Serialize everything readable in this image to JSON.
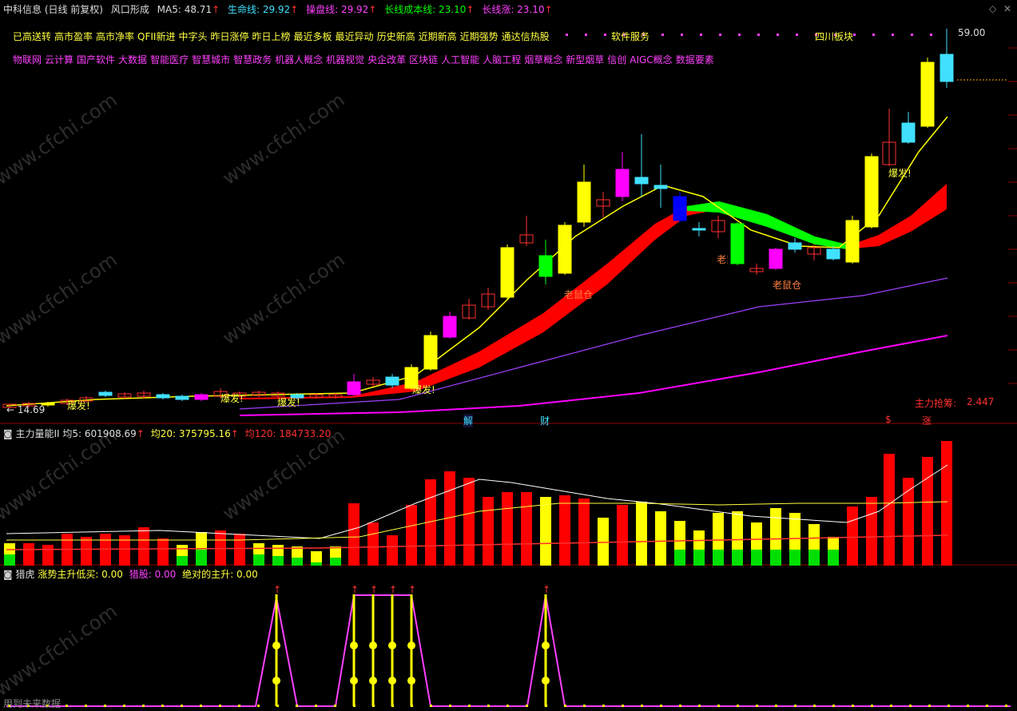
{
  "header": {
    "stock": "中科信息 (日线 前复权)",
    "indicator": "风口形成",
    "ma5": "MA5: 48.71",
    "lifeline": "生命线: 29.92",
    "opline": "操盘线: 29.92",
    "longcost": "长线成本线: 23.10",
    "longrise": "长线涨: 23.10",
    "arrow": "↑"
  },
  "tags_row1": [
    "已高送转",
    "高市盈率",
    "高市净率",
    "QFII新进",
    "中字头",
    "昨日涨停",
    "昨日上榜",
    "最近多板",
    "最近异动",
    "历史新高",
    "近期新高",
    "近期强势",
    "通达信热股"
  ],
  "tags_row1_extra": {
    "software": "软件服务",
    "sichuan": "四川板块"
  },
  "tags_row2": [
    "物联网",
    "云计算",
    "国产软件",
    "大数据",
    "智能医疗",
    "智慧城市",
    "智慧政务",
    "机器人概念",
    "机器视觉",
    "央企改革",
    "区块链",
    "人工智能",
    "人脑工程",
    "烟草概念",
    "新型烟草",
    "信创",
    "AIGC概念",
    "数据要素"
  ],
  "price_labels": {
    "high": "59.00",
    "low": "← 14.69",
    "baofa": "爆发!",
    "laoshucang": "老鼠仓",
    "mainforce": "主力抢筹:",
    "mainforce_value": "2.447",
    "jie": "解",
    "cai": "财",
    "zhang": "涨",
    "s": "$"
  },
  "panel2": {
    "title": "主力量能II",
    "avg5": "均5: 601908.69",
    "avg20": "均20: 375795.16",
    "avg120": "均120: 184733.20"
  },
  "panel3": {
    "title": "猎虎",
    "v1": "涨势主升低买: 0.00",
    "v2": "猎股: 0.00",
    "v3": "绝对的主升: 0.00"
  },
  "footer": "用到未来数据",
  "watermark": "www.cfchi.com",
  "colors": {
    "yellow": "#ffff00",
    "magenta": "#ff00ff",
    "red": "#ff0000",
    "green": "#00ff00",
    "cyan": "#40e0ff",
    "blue": "#0000ff"
  }
}
